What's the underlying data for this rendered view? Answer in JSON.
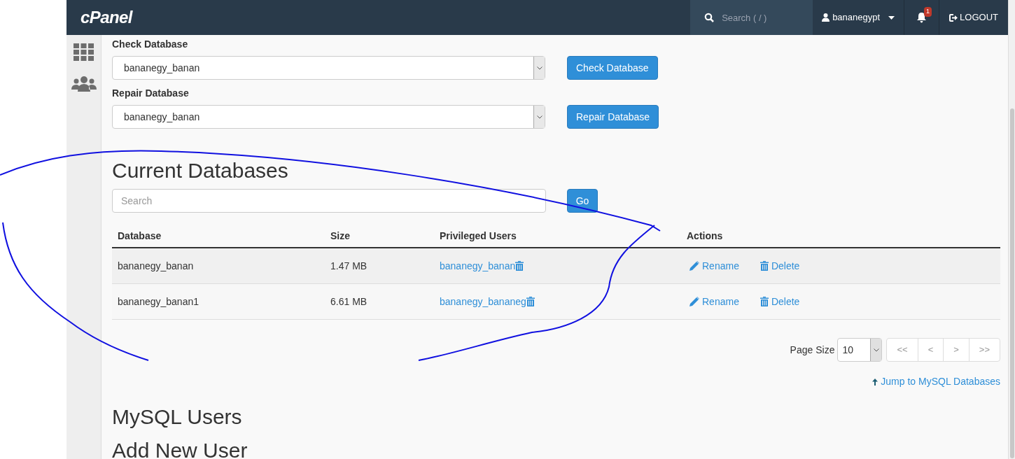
{
  "header": {
    "logo": "cPanel",
    "search": {
      "placeholder": "Search ( / )"
    },
    "user": "bananegypt",
    "notifications": "1",
    "logout": "LOGOUT"
  },
  "check": {
    "label": "Check Database",
    "value": "bananegy_banan",
    "button": "Check Database"
  },
  "repair": {
    "label": "Repair Database",
    "value": "bananegy_banan",
    "button": "Repair Database"
  },
  "current": {
    "title": "Current Databases",
    "search": {
      "placeholder": "Search"
    },
    "go": "Go",
    "table": {
      "columns": [
        "Database",
        "Size",
        "Privileged Users",
        "Actions"
      ],
      "rows": [
        {
          "database": "bananegy_banan",
          "size": "1.47 MB",
          "user": "bananegy_banan",
          "rename": "Rename",
          "delete": "Delete"
        },
        {
          "database": "bananegy_banan1",
          "size": "6.61 MB",
          "user": "bananegy_bananeg",
          "rename": "Rename",
          "delete": "Delete"
        }
      ]
    },
    "page_size": {
      "label": "Page Size",
      "value": "10"
    },
    "pager": [
      "<<",
      "<",
      ">",
      ">>"
    ],
    "jump": "Jump to MySQL Databases"
  },
  "mysql_users": "MySQL Users",
  "add_user": "Add New User"
}
